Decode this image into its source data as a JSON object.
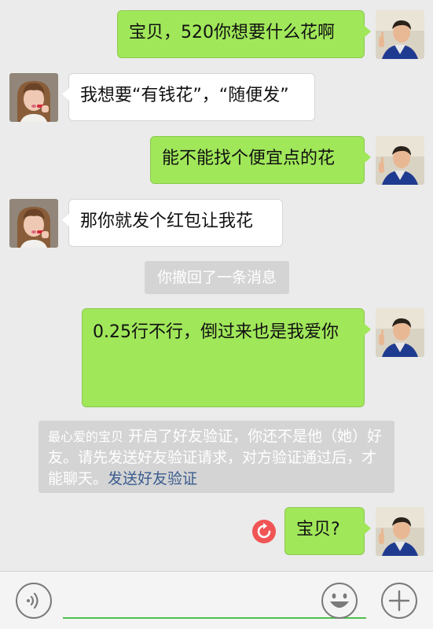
{
  "messages": [
    {
      "from": "me",
      "text": "宝贝，520你想要什么花啊",
      "avatar": "male-avatar"
    },
    {
      "from": "her",
      "text": "我想要“有钱花”，“随便发”",
      "avatar": "female-avatar"
    },
    {
      "from": "me",
      "text": "能不能找个便宜点的花",
      "avatar": "male-avatar"
    },
    {
      "from": "her",
      "text": "那你就发个红包让我花",
      "avatar": "female-avatar"
    },
    {
      "from": "me",
      "text": "0.25行不行，倒过来也是我爱你",
      "avatar": "male-avatar"
    },
    {
      "from": "me",
      "text": "宝贝?",
      "avatar": "male-avatar",
      "failed": true
    }
  ],
  "system": {
    "recall": "你撤回了一条消息",
    "verify_nick": "最心爱的宝贝",
    "verify_text": " 开启了好友验证，你还不是他（她）好友。请先发送好友验证请求，对方验证通过后，才能聊天。",
    "verify_link": "发送好友验证"
  },
  "colors": {
    "my_bubble": "#a0e75a",
    "her_bubble": "#ffffff",
    "system_bg": "#d4d4d4",
    "link": "#3b5c8f",
    "failed_icon": "#f05454",
    "input_underline": "#4cc14c"
  },
  "toolbar": {
    "voice_icon": "voice-icon",
    "emoji_icon": "emoji-icon",
    "plus_icon": "plus-icon",
    "input_value": ""
  }
}
